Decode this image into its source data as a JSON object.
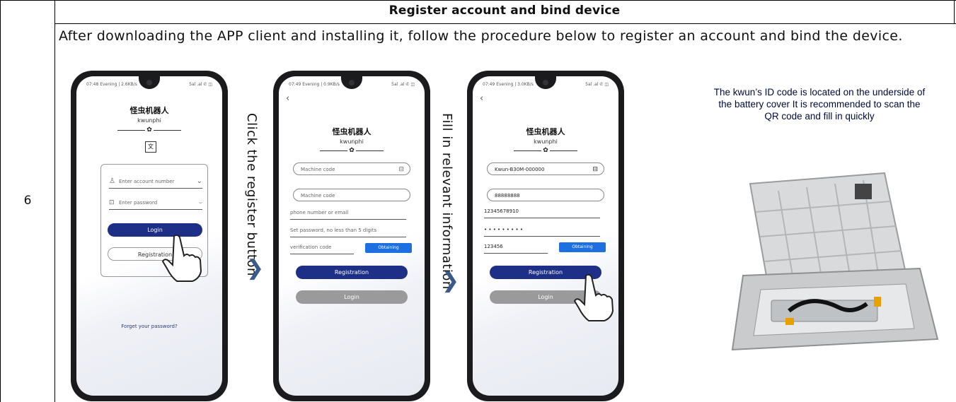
{
  "title": "Register account and bind device",
  "row_number": "6",
  "intro": "After downloading the APP client and installing it, follow the procedure below to register an account and bind the device.",
  "step1_label": "Click the register button",
  "step2_label": "Fill in relevant information",
  "note": "The kwun’s ID code is located on the underside of the battery cover It is recommended to scan the QR code and fill in quickly",
  "phones": [
    {
      "status_left": "07:48 Evening | 2.6KB/s",
      "status_right": "5al .al ✆ ◫",
      "app_name": "怪虫机器人",
      "app_sub": "kwunphi",
      "account_placeholder": "Enter account number",
      "password_placeholder": "Enter password",
      "login": "Login",
      "registration": "Registration",
      "forgot": "Forget your password?"
    },
    {
      "status_left": "07:49 Evening | 0.9KB/s",
      "status_right": "5al .al ✆ ◫",
      "app_name": "怪虫机器人",
      "app_sub": "kwunphi",
      "machine_code_1": "Machine code",
      "machine_code_2": "Machine code",
      "phone_email": "phone number or email",
      "password_hint": "Set password, no less than 5 digits",
      "verification": "verification code",
      "obtaining": "Obtaining",
      "registration": "Registration",
      "login": "Login"
    },
    {
      "status_left": "07:49 Evening | 3.0KB/s",
      "status_right": "5al .al ✆ ◫",
      "app_name": "怪虫机器人",
      "app_sub": "kwunphi",
      "machine_code": "Kwun-B30M-000000",
      "code2": "88888888",
      "phone": "12345678910",
      "password_dots": "• • • • • • • • •",
      "verification": "123456",
      "obtaining": "Obtaining",
      "registration": "Registration",
      "login": "Login"
    }
  ]
}
